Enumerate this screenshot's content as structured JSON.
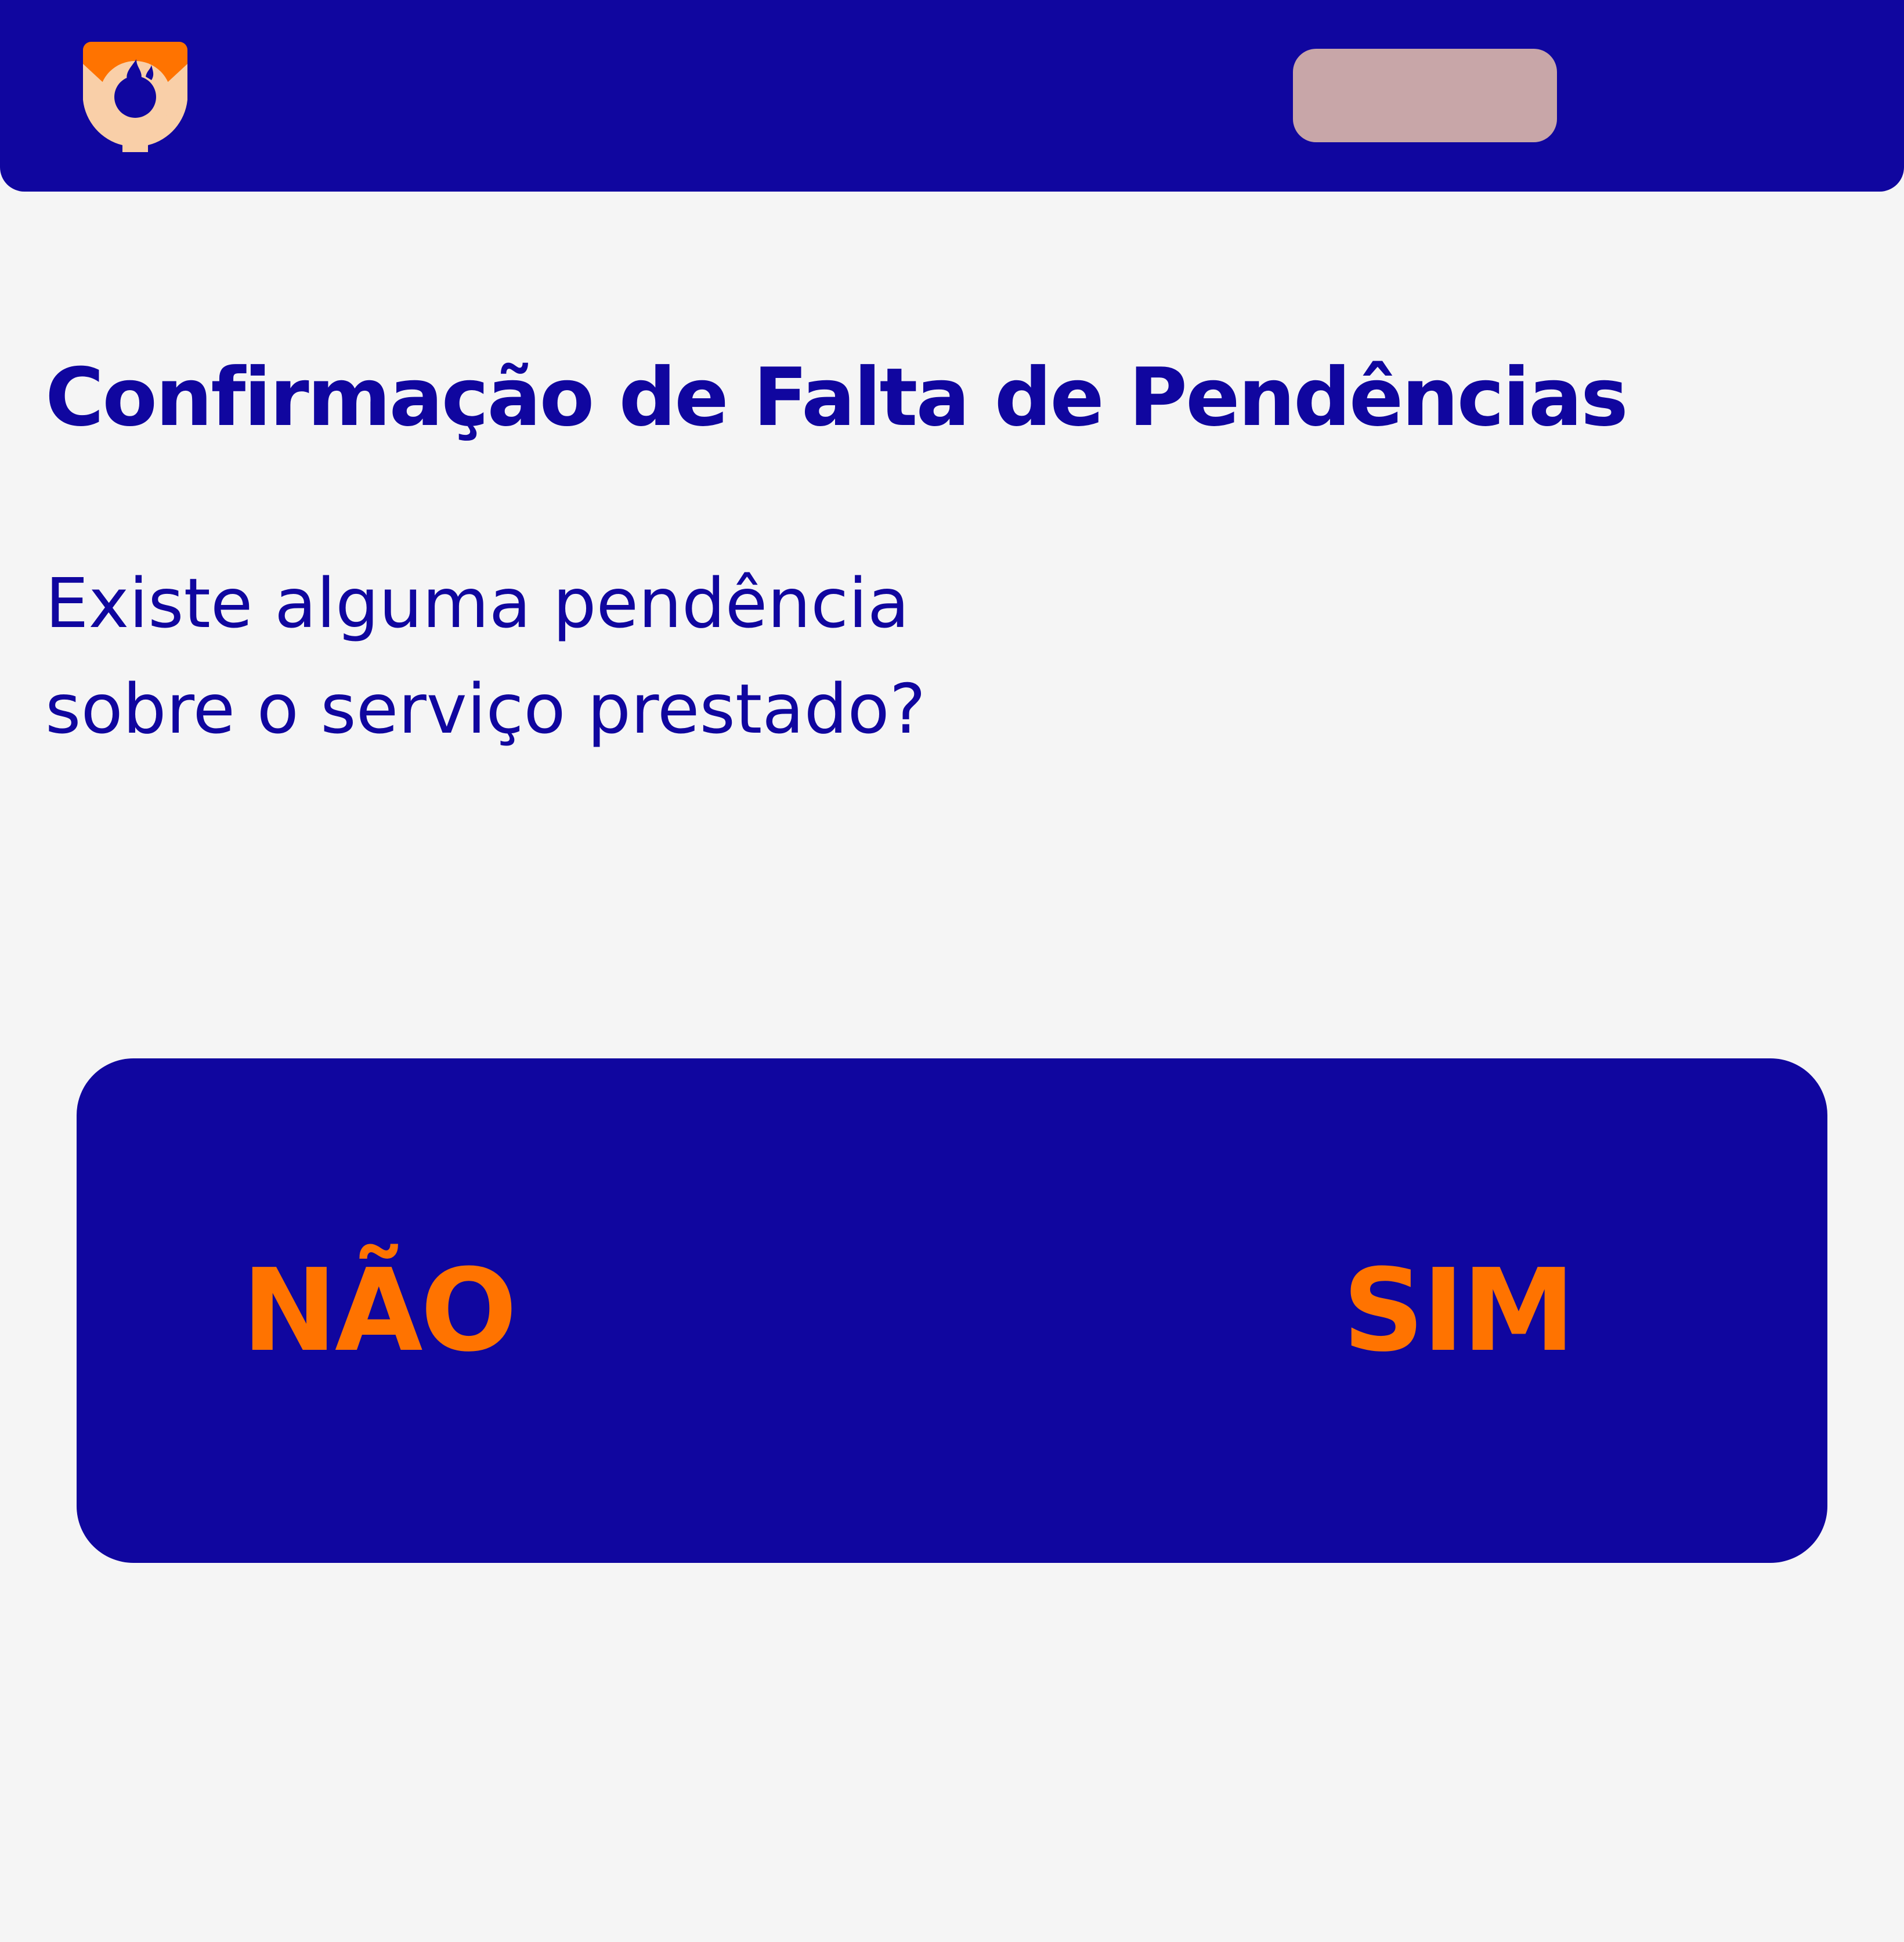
{
  "colors": {
    "primary": "#10069f",
    "accent": "#ff7300",
    "background": "#f5f5f5",
    "header_pill": "#c8a6a8",
    "logo_light": "#f9cfa8"
  },
  "header": {
    "logo_icon": "flame-shield-logo-icon",
    "pill_label": ""
  },
  "page": {
    "title": "Confirmação de Falta de Pendências",
    "question": "Existe alguma pendência\nsobre o serviço prestado?"
  },
  "choices": {
    "no_label": "NÃO",
    "yes_label": "SIM"
  }
}
